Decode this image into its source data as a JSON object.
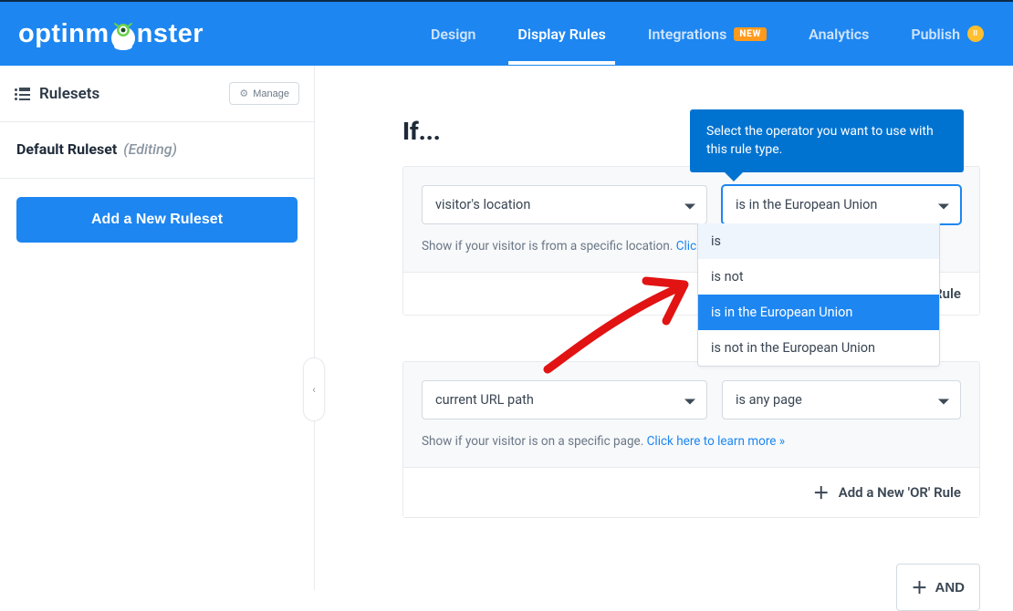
{
  "logo": {
    "pre": "optinm",
    "post": "nster"
  },
  "nav": [
    {
      "label": "Design"
    },
    {
      "label": "Display Rules"
    },
    {
      "label": "Integrations",
      "badge": "NEW"
    },
    {
      "label": "Analytics"
    },
    {
      "label": "Publish",
      "pill": "II"
    }
  ],
  "sidebar": {
    "title": "Rulesets",
    "manage": "Manage",
    "ruleset_name": "Default Ruleset",
    "editing": "(Editing)",
    "add_button": "Add a New Ruleset"
  },
  "tooltip": "Select the operator you want to use with this rule type.",
  "if_heading": "If...",
  "block1": {
    "condition": "visitor's location",
    "operator": "is in the European Union",
    "hint_text": "Show if your visitor is from a specific location. ",
    "hint_link_partial": "Clic",
    "or_label": "Rule"
  },
  "dropdown": {
    "options": [
      {
        "label": "is",
        "state": "highlight"
      },
      {
        "label": "is not",
        "state": ""
      },
      {
        "label": "is in the European Union",
        "state": "selected"
      },
      {
        "label": "is not in the European Union",
        "state": ""
      }
    ]
  },
  "block2": {
    "condition": "current URL path",
    "operator": "is any page",
    "hint_text": "Show if your visitor is on a specific page. ",
    "hint_link": "Click here to learn more »",
    "or_label": "Add a New 'OR' Rule"
  },
  "and_button": "AND"
}
